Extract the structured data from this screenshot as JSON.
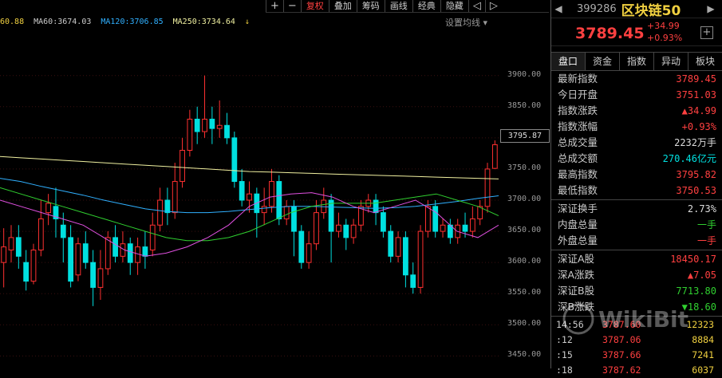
{
  "toolbar": {
    "buttons": [
      {
        "label": "+",
        "sym": true
      },
      {
        "label": "−",
        "sym": true
      },
      {
        "label": "复权",
        "active": true
      },
      {
        "label": "叠加"
      },
      {
        "label": "筹码"
      },
      {
        "label": "画线"
      },
      {
        "label": "经典"
      },
      {
        "label": "隐藏"
      },
      {
        "label": "◁",
        "sym": true
      },
      {
        "label": "▷",
        "sym": true
      }
    ]
  },
  "ma_legend": [
    {
      "text": "60.88",
      "color": "#f0d040"
    },
    {
      "text": "MA60:3674.03",
      "color": "#cccccc"
    },
    {
      "text": "MA120:3706.85",
      "color": "#30b0ff"
    },
    {
      "text": "MA250:3734.64",
      "color": "#f0f0a0"
    }
  ],
  "ma_arrow": "↓",
  "settings_label": "设置均线",
  "colors": {
    "up": "#ff3030",
    "down": "#00e0e0"
  },
  "chart_data": {
    "type": "candlestick",
    "y_ticks": [
      "3900.00",
      "3850.00",
      "3800.00",
      "3750.00",
      "3700.00",
      "3650.00",
      "3600.00",
      "3550.00",
      "3500.00",
      "3450.00"
    ],
    "ylim": [
      3430,
      3970
    ],
    "current_price_label": "3795.87",
    "candles": [
      [
        3600,
        3625,
        3560,
        3655
      ],
      [
        3620,
        3640,
        3600,
        3660
      ],
      [
        3640,
        3610,
        3590,
        3660
      ],
      [
        3600,
        3570,
        3555,
        3620
      ],
      [
        3570,
        3620,
        3565,
        3630
      ],
      [
        3620,
        3670,
        3610,
        3700
      ],
      [
        3680,
        3695,
        3660,
        3710
      ],
      [
        3690,
        3670,
        3640,
        3720
      ],
      [
        3660,
        3640,
        3600,
        3680
      ],
      [
        3640,
        3570,
        3560,
        3660
      ],
      [
        3580,
        3630,
        3570,
        3640
      ],
      [
        3630,
        3600,
        3590,
        3650
      ],
      [
        3600,
        3560,
        3530,
        3620
      ],
      [
        3560,
        3590,
        3540,
        3620
      ],
      [
        3590,
        3640,
        3580,
        3650
      ],
      [
        3640,
        3610,
        3600,
        3660
      ],
      [
        3610,
        3630,
        3600,
        3650
      ],
      [
        3630,
        3600,
        3580,
        3640
      ],
      [
        3600,
        3625,
        3580,
        3640
      ],
      [
        3625,
        3610,
        3590,
        3650
      ],
      [
        3620,
        3660,
        3610,
        3680
      ],
      [
        3660,
        3700,
        3650,
        3720
      ],
      [
        3700,
        3680,
        3660,
        3720
      ],
      [
        3680,
        3730,
        3670,
        3760
      ],
      [
        3730,
        3780,
        3720,
        3800
      ],
      [
        3780,
        3830,
        3770,
        3845
      ],
      [
        3830,
        3810,
        3790,
        3850
      ],
      [
        3810,
        3830,
        3800,
        3900
      ],
      [
        3830,
        3815,
        3790,
        3850
      ],
      [
        3815,
        3820,
        3800,
        3860
      ],
      [
        3820,
        3800,
        3790,
        3840
      ],
      [
        3800,
        3730,
        3720,
        3810
      ],
      [
        3730,
        3700,
        3690,
        3750
      ],
      [
        3700,
        3710,
        3680,
        3730
      ],
      [
        3710,
        3680,
        3640,
        3720
      ],
      [
        3680,
        3690,
        3660,
        3720
      ],
      [
        3690,
        3730,
        3680,
        3750
      ],
      [
        3730,
        3670,
        3660,
        3740
      ],
      [
        3670,
        3690,
        3660,
        3700
      ],
      [
        3690,
        3650,
        3610,
        3700
      ],
      [
        3650,
        3600,
        3590,
        3660
      ],
      [
        3600,
        3630,
        3590,
        3650
      ],
      [
        3630,
        3680,
        3620,
        3700
      ],
      [
        3680,
        3700,
        3670,
        3720
      ],
      [
        3700,
        3650,
        3600,
        3710
      ],
      [
        3650,
        3660,
        3640,
        3680
      ],
      [
        3660,
        3640,
        3620,
        3670
      ],
      [
        3640,
        3660,
        3630,
        3670
      ],
      [
        3660,
        3690,
        3650,
        3700
      ],
      [
        3690,
        3700,
        3680,
        3710
      ],
      [
        3700,
        3680,
        3660,
        3710
      ],
      [
        3680,
        3650,
        3640,
        3690
      ],
      [
        3650,
        3610,
        3600,
        3660
      ],
      [
        3610,
        3640,
        3600,
        3650
      ],
      [
        3640,
        3580,
        3560,
        3650
      ],
      [
        3580,
        3560,
        3550,
        3600
      ],
      [
        3560,
        3650,
        3550,
        3660
      ],
      [
        3650,
        3690,
        3640,
        3700
      ],
      [
        3690,
        3650,
        3640,
        3700
      ],
      [
        3650,
        3660,
        3640,
        3670
      ],
      [
        3660,
        3640,
        3630,
        3670
      ],
      [
        3640,
        3660,
        3630,
        3670
      ],
      [
        3660,
        3650,
        3640,
        3680
      ],
      [
        3650,
        3670,
        3640,
        3690
      ],
      [
        3670,
        3690,
        3660,
        3700
      ],
      [
        3690,
        3750,
        3680,
        3760
      ],
      [
        3751,
        3789,
        3750,
        3796
      ]
    ],
    "ma_lines": [
      {
        "color": "#f0f0a0",
        "values": [
          3770,
          3768,
          3766,
          3764,
          3762,
          3760,
          3758,
          3756,
          3754,
          3752,
          3750,
          3748,
          3746,
          3745,
          3744,
          3743,
          3742,
          3741,
          3740,
          3739,
          3738,
          3737,
          3736,
          3735,
          3734
        ]
      },
      {
        "color": "#30b0ff",
        "values": [
          3735,
          3730,
          3722,
          3715,
          3708,
          3700,
          3693,
          3686,
          3682,
          3680,
          3680,
          3682,
          3685,
          3688,
          3690,
          3690,
          3689,
          3688,
          3687,
          3688,
          3690,
          3694,
          3698,
          3703,
          3707
        ]
      },
      {
        "color": "#30d030",
        "values": [
          3720,
          3710,
          3700,
          3690,
          3680,
          3670,
          3660,
          3650,
          3640,
          3635,
          3635,
          3640,
          3650,
          3665,
          3680,
          3690,
          3695,
          3695,
          3695,
          3700,
          3705,
          3710,
          3700,
          3690,
          3675
        ]
      },
      {
        "color": "#e050e0",
        "values": [
          3700,
          3690,
          3680,
          3670,
          3660,
          3640,
          3620,
          3610,
          3615,
          3625,
          3640,
          3660,
          3690,
          3705,
          3710,
          3712,
          3705,
          3690,
          3680,
          3690,
          3700,
          3680,
          3650,
          3640,
          3660
        ]
      }
    ]
  },
  "panel": {
    "code": "399286",
    "name": "区块链50",
    "price": "3789.45",
    "change_abs": "+34.99",
    "change_pct": "+0.93%",
    "add_label": "+",
    "tabs": [
      "盘口",
      "资金",
      "指数",
      "异动",
      "板块"
    ],
    "rows_top": [
      {
        "label": "最新指数",
        "value": "3789.45",
        "cls": "red"
      },
      {
        "label": "今日开盘",
        "value": "3751.03",
        "cls": "red"
      },
      {
        "label": "指数涨跌",
        "value": "▲34.99",
        "cls": "red"
      },
      {
        "label": "指数涨幅",
        "value": "+0.93%",
        "cls": "red"
      },
      {
        "label": "总成交量",
        "value": "2232万手",
        "cls": "white"
      },
      {
        "label": "总成交额",
        "value": "270.46亿元",
        "cls": "cyan"
      },
      {
        "label": "最高指数",
        "value": "3795.82",
        "cls": "red"
      },
      {
        "label": "最低指数",
        "value": "3750.53",
        "cls": "red"
      }
    ],
    "rows_mid": [
      {
        "label": "深证换手",
        "value": "2.73%",
        "cls": "white"
      },
      {
        "label": "内盘总量",
        "value": "一手",
        "cls": "green"
      },
      {
        "label": "外盘总量",
        "value": "一手",
        "cls": "red"
      }
    ],
    "rows_bot": [
      {
        "label": "深证A股",
        "value": "18450.17",
        "cls": "red"
      },
      {
        "label": "深A涨跌",
        "value": "▲7.05",
        "cls": "red"
      },
      {
        "label": "深证B股",
        "value": "7713.80",
        "cls": "green"
      },
      {
        "label": "深B涨跌",
        "value": "▼18.60",
        "cls": "green"
      }
    ],
    "ticks": [
      {
        "time": "14:56",
        "price": "3787.60",
        "vol": "12323"
      },
      {
        "time": ":12",
        "price": "3787.06",
        "vol": "8884"
      },
      {
        "time": ":15",
        "price": "3787.66",
        "vol": "7241"
      },
      {
        "time": ":18",
        "price": "3787.62",
        "vol": "6037"
      }
    ]
  }
}
